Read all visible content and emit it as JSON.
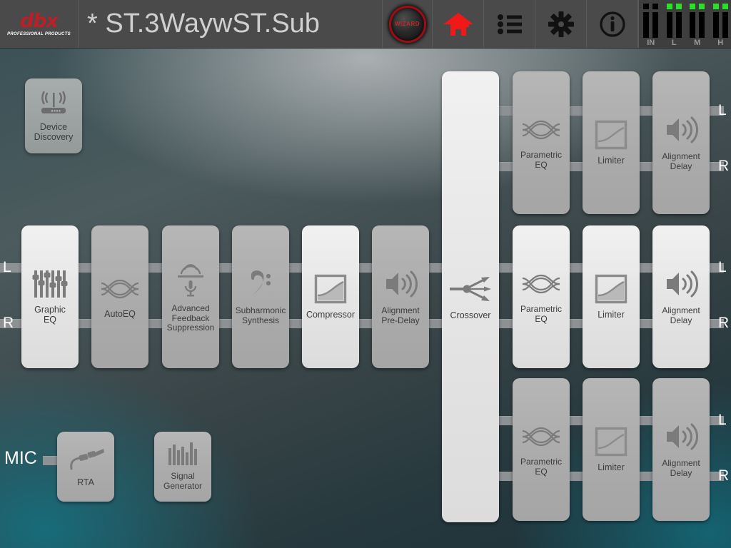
{
  "header": {
    "logo": {
      "brand": "dbx",
      "tagline": "PROFESSIONAL PRODUCTS"
    },
    "preset_title": "* ST.3WaywST.Sub",
    "wizard_label": "WIZARD",
    "buttons": [
      {
        "name": "wizard-button",
        "label": "WIZARD",
        "icon": "wizard-knob-icon"
      },
      {
        "name": "home-button",
        "label": "Home",
        "icon": "home-icon"
      },
      {
        "name": "list-button",
        "label": "List",
        "icon": "list-icon"
      },
      {
        "name": "settings-button",
        "label": "Settings",
        "icon": "gear-icon"
      },
      {
        "name": "info-button",
        "label": "Info",
        "icon": "info-icon"
      }
    ],
    "meters": [
      {
        "label": "IN",
        "leds": [
          "off",
          "off"
        ],
        "bars": 2
      },
      {
        "label": "L",
        "leds": [
          "on",
          "on"
        ],
        "bars": 2
      },
      {
        "label": "M",
        "leds": [
          "on",
          "on"
        ],
        "bars": 2
      },
      {
        "label": "H",
        "leds": [
          "on",
          "on"
        ],
        "bars": 2
      }
    ],
    "colors": {
      "brand_red": "#bb2026",
      "led_green": "#27e327",
      "header_bg": "#4a4a4a"
    }
  },
  "canvas": {
    "device_discovery": {
      "label": "Device\nDiscovery",
      "line1": "Device",
      "line2": "Discovery",
      "icon": "wireless-router-icon",
      "state": "off"
    },
    "input_labels": {
      "left": "L",
      "right": "R",
      "mic": "MIC"
    },
    "output_labels": {
      "left": "L",
      "right": "R"
    },
    "input_chain": [
      {
        "name": "graphic-eq",
        "line1": "Graphic",
        "line2": "EQ",
        "line3": "",
        "icon": "sliders-icon",
        "state": "on"
      },
      {
        "name": "auto-eq",
        "line1": "AutoEQ",
        "line2": "",
        "line3": "",
        "icon": "eq-curve-icon",
        "state": "off"
      },
      {
        "name": "advanced-feedback-suppression",
        "line1": "Advanced",
        "line2": "Feedback",
        "line3": "Suppression",
        "icon": "feedback-mic-icon",
        "state": "off"
      },
      {
        "name": "subharmonic-synthesis",
        "line1": "Subharmonic",
        "line2": "Synthesis",
        "line3": "",
        "icon": "bass-clef-icon",
        "state": "off"
      },
      {
        "name": "compressor",
        "line1": "Compressor",
        "line2": "",
        "line3": "",
        "icon": "compressor-curve-icon",
        "state": "on"
      },
      {
        "name": "alignment-pre-delay",
        "line1": "Alignment",
        "line2": "Pre-Delay",
        "line3": "",
        "icon": "speaker-wave-icon",
        "state": "off"
      }
    ],
    "crossover": {
      "name": "crossover",
      "label": "Crossover",
      "icon": "crossover-split-icon",
      "state": "on"
    },
    "output_rows": [
      {
        "name": "output-row-high",
        "blocks": [
          {
            "name": "parametric-eq",
            "line1": "Parametric",
            "line2": "EQ",
            "icon": "eq-curve-icon",
            "state": "off"
          },
          {
            "name": "limiter",
            "line1": "Limiter",
            "line2": "",
            "icon": "compressor-curve-icon",
            "state": "off"
          },
          {
            "name": "alignment-delay",
            "line1": "Alignment",
            "line2": "Delay",
            "icon": "speaker-wave-icon",
            "state": "off"
          }
        ]
      },
      {
        "name": "output-row-mid",
        "blocks": [
          {
            "name": "parametric-eq",
            "line1": "Parametric",
            "line2": "EQ",
            "icon": "eq-curve-icon",
            "state": "on"
          },
          {
            "name": "limiter",
            "line1": "Limiter",
            "line2": "",
            "icon": "compressor-curve-icon",
            "state": "on"
          },
          {
            "name": "alignment-delay",
            "line1": "Alignment",
            "line2": "Delay",
            "icon": "speaker-wave-icon",
            "state": "on"
          }
        ]
      },
      {
        "name": "output-row-low",
        "blocks": [
          {
            "name": "parametric-eq",
            "line1": "Parametric",
            "line2": "EQ",
            "icon": "eq-curve-icon",
            "state": "off"
          },
          {
            "name": "limiter",
            "line1": "Limiter",
            "line2": "",
            "icon": "compressor-curve-icon",
            "state": "off"
          },
          {
            "name": "alignment-delay",
            "line1": "Alignment",
            "line2": "Delay",
            "icon": "speaker-wave-icon",
            "state": "off"
          }
        ]
      }
    ],
    "utilities": [
      {
        "name": "rta",
        "line1": "RTA",
        "line2": "",
        "icon": "mic-cable-icon",
        "state": "off"
      },
      {
        "name": "signal-generator",
        "line1": "Signal",
        "line2": "Generator",
        "icon": "signal-bars-icon",
        "state": "off"
      }
    ]
  }
}
